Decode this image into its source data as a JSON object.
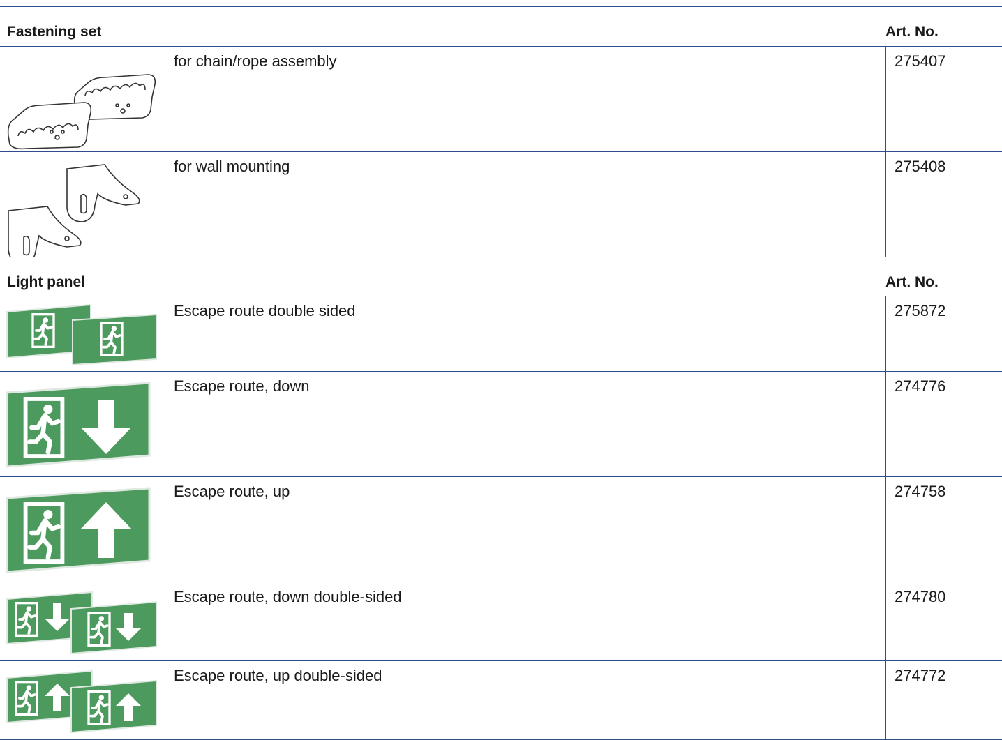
{
  "sections": [
    {
      "title": "Fastening set",
      "art_header": "Art. No.",
      "rows": [
        {
          "icon": "chain-rope-bracket-icon",
          "description": "for chain/rope assembly",
          "art_no": "275407"
        },
        {
          "icon": "wall-mount-bracket-icon",
          "description": "for wall mounting",
          "art_no": "275408"
        }
      ]
    },
    {
      "title": "Light panel",
      "art_header": "Art. No.",
      "rows": [
        {
          "icon": "escape-route-double-sided-icon",
          "description": "Escape route double sided",
          "art_no": "275872"
        },
        {
          "icon": "escape-route-down-icon",
          "description": "Escape route, down",
          "art_no": "274776"
        },
        {
          "icon": "escape-route-up-icon",
          "description": "Escape route, up",
          "art_no": "274758"
        },
        {
          "icon": "escape-route-down-double-sided-icon",
          "description": "Escape route, down double-sided",
          "art_no": "274780"
        },
        {
          "icon": "escape-route-up-double-sided-icon",
          "description": "Escape route, up double-sided",
          "art_no": "274772"
        }
      ]
    }
  ],
  "colors": {
    "rule": "#2c4f8c",
    "sign_green": "#4d9a5e"
  }
}
